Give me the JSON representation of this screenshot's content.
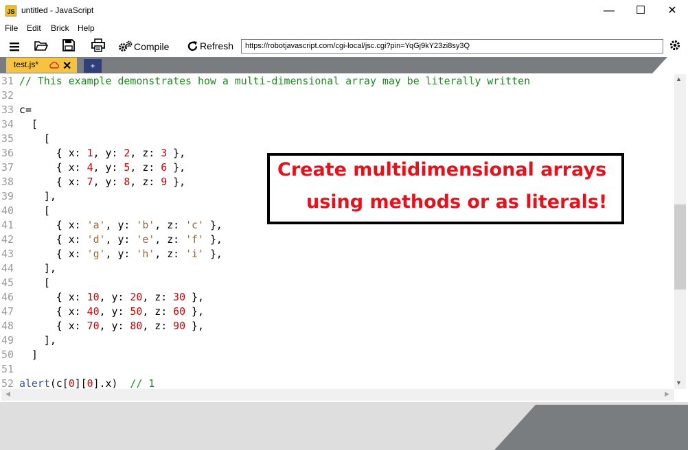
{
  "window": {
    "title": "untitled - JavaScript",
    "app_icon_text": "JS",
    "controls": {
      "minimize": "—",
      "maximize": "☐",
      "close": "✕"
    }
  },
  "menu": [
    "File",
    "Edit",
    "Brick",
    "Help"
  ],
  "toolbar": {
    "compile_label": "Compile",
    "refresh_label": "Refresh",
    "url": "https://robotjavascript.com/cgi-local/jsc.cgi?pin=YqGj9kY23zi8sy3Q"
  },
  "tabs": [
    {
      "label": "test.js*",
      "close": "✕"
    }
  ],
  "add_tab_label": "+",
  "colors": {
    "comment": "#1f8a1f",
    "number": "#d00000",
    "string": "#9a6a3a",
    "keyword": "#3050b0",
    "tab_active": "#f5c242",
    "callout_text": "#e8111b"
  },
  "code_lines": [
    {
      "n": "31",
      "tokens": [
        {
          "t": "// This example demonstrates how a multi-dimensional array may be literally written",
          "c": "cm"
        }
      ]
    },
    {
      "n": "32",
      "tokens": []
    },
    {
      "n": "33",
      "tokens": [
        {
          "t": "c="
        }
      ]
    },
    {
      "n": "34",
      "tokens": [
        {
          "t": "  ["
        }
      ]
    },
    {
      "n": "35",
      "tokens": [
        {
          "t": "    ["
        }
      ]
    },
    {
      "n": "36",
      "tokens": [
        {
          "t": "      { x: "
        },
        {
          "t": "1",
          "c": "nm"
        },
        {
          "t": ", y: "
        },
        {
          "t": "2",
          "c": "nm"
        },
        {
          "t": ", z: "
        },
        {
          "t": "3",
          "c": "nm"
        },
        {
          "t": " },"
        }
      ]
    },
    {
      "n": "37",
      "tokens": [
        {
          "t": "      { x: "
        },
        {
          "t": "4",
          "c": "nm"
        },
        {
          "t": ", y: "
        },
        {
          "t": "5",
          "c": "nm"
        },
        {
          "t": ", z: "
        },
        {
          "t": "6",
          "c": "nm"
        },
        {
          "t": " },"
        }
      ]
    },
    {
      "n": "38",
      "tokens": [
        {
          "t": "      { x: "
        },
        {
          "t": "7",
          "c": "nm"
        },
        {
          "t": ", y: "
        },
        {
          "t": "8",
          "c": "nm"
        },
        {
          "t": ", z: "
        },
        {
          "t": "9",
          "c": "nm"
        },
        {
          "t": " },"
        }
      ]
    },
    {
      "n": "39",
      "tokens": [
        {
          "t": "    ],"
        }
      ]
    },
    {
      "n": "40",
      "tokens": [
        {
          "t": "    ["
        }
      ]
    },
    {
      "n": "41",
      "tokens": [
        {
          "t": "      { x: "
        },
        {
          "t": "'a'",
          "c": "st"
        },
        {
          "t": ", y: "
        },
        {
          "t": "'b'",
          "c": "st"
        },
        {
          "t": ", z: "
        },
        {
          "t": "'c'",
          "c": "st"
        },
        {
          "t": " },"
        }
      ]
    },
    {
      "n": "42",
      "tokens": [
        {
          "t": "      { x: "
        },
        {
          "t": "'d'",
          "c": "st"
        },
        {
          "t": ", y: "
        },
        {
          "t": "'e'",
          "c": "st"
        },
        {
          "t": ", z: "
        },
        {
          "t": "'f'",
          "c": "st"
        },
        {
          "t": " },"
        }
      ]
    },
    {
      "n": "43",
      "tokens": [
        {
          "t": "      { x: "
        },
        {
          "t": "'g'",
          "c": "st"
        },
        {
          "t": ", y: "
        },
        {
          "t": "'h'",
          "c": "st"
        },
        {
          "t": ", z: "
        },
        {
          "t": "'i'",
          "c": "st"
        },
        {
          "t": " },"
        }
      ]
    },
    {
      "n": "44",
      "tokens": [
        {
          "t": "    ],"
        }
      ]
    },
    {
      "n": "45",
      "tokens": [
        {
          "t": "    ["
        }
      ]
    },
    {
      "n": "46",
      "tokens": [
        {
          "t": "      { x: "
        },
        {
          "t": "10",
          "c": "nm"
        },
        {
          "t": ", y: "
        },
        {
          "t": "20",
          "c": "nm"
        },
        {
          "t": ", z: "
        },
        {
          "t": "30",
          "c": "nm"
        },
        {
          "t": " },"
        }
      ]
    },
    {
      "n": "47",
      "tokens": [
        {
          "t": "      { x: "
        },
        {
          "t": "40",
          "c": "nm"
        },
        {
          "t": ", y: "
        },
        {
          "t": "50",
          "c": "nm"
        },
        {
          "t": ", z: "
        },
        {
          "t": "60",
          "c": "nm"
        },
        {
          "t": " },"
        }
      ]
    },
    {
      "n": "48",
      "tokens": [
        {
          "t": "      { x: "
        },
        {
          "t": "70",
          "c": "nm"
        },
        {
          "t": ", y: "
        },
        {
          "t": "80",
          "c": "nm"
        },
        {
          "t": ", z: "
        },
        {
          "t": "90",
          "c": "nm"
        },
        {
          "t": " },"
        }
      ]
    },
    {
      "n": "49",
      "tokens": [
        {
          "t": "    ],"
        }
      ]
    },
    {
      "n": "50",
      "tokens": [
        {
          "t": "  ]"
        }
      ]
    },
    {
      "n": "51",
      "tokens": []
    },
    {
      "n": "52",
      "tokens": [
        {
          "t": "alert",
          "c": "kw"
        },
        {
          "t": "(c["
        },
        {
          "t": "0",
          "c": "nm"
        },
        {
          "t": "]["
        },
        {
          "t": "0",
          "c": "nm"
        },
        {
          "t": "].x)  "
        },
        {
          "t": "// 1",
          "c": "cm"
        }
      ]
    }
  ],
  "callout": {
    "line1": "Create multidimensional arrays",
    "line2": "using methods or as literals!"
  },
  "scroll": {
    "vertical_position": 0.55
  }
}
